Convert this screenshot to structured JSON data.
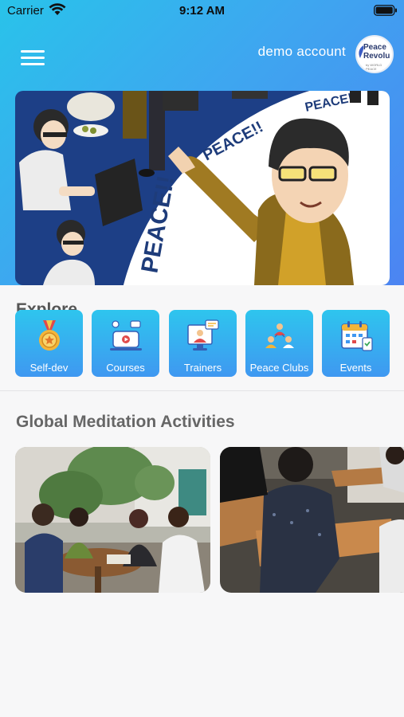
{
  "status_bar": {
    "carrier": "Carrier",
    "time": "9:12 AM",
    "icons": [
      "wifi-icon",
      "battery-icon"
    ]
  },
  "header": {
    "account_name": "demo account",
    "avatar_text": "Peace Revolu",
    "avatar_subtext": "by WORLD PEACE",
    "banner_texts": [
      "PEACE!!",
      "PEACE!",
      "PEACE!!"
    ]
  },
  "explore": {
    "title": "Explore",
    "tiles": [
      {
        "label": "Self-dev",
        "icon": "medal-icon"
      },
      {
        "label": "Courses",
        "icon": "course-icon"
      },
      {
        "label": "Trainers",
        "icon": "trainer-icon"
      },
      {
        "label": "Peace Clubs",
        "icon": "club-icon"
      },
      {
        "label": "Events",
        "icon": "calendar-icon"
      }
    ]
  },
  "activities": {
    "title": "Global Meditation Activities"
  },
  "colors": {
    "header_gradient_start": "#29c3ea",
    "header_gradient_end": "#4c84f2",
    "tile_start": "#2ec5ee",
    "tile_end": "#3f98f1"
  }
}
